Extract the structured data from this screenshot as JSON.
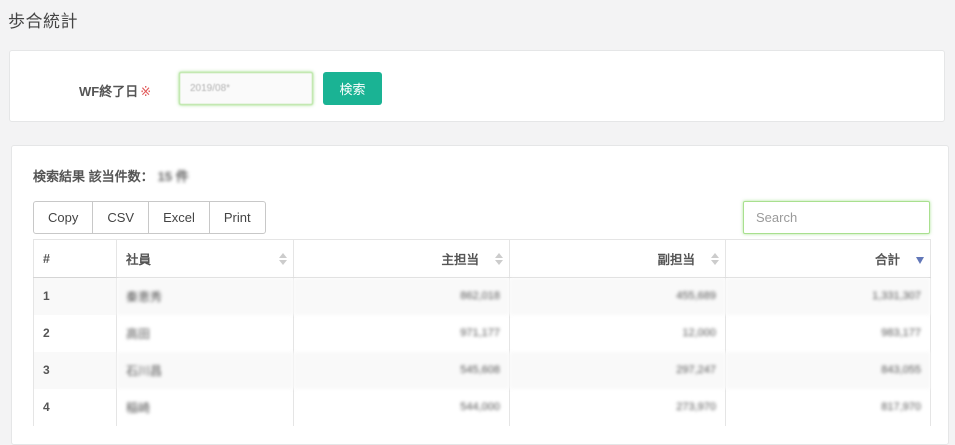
{
  "page": {
    "title": "歩合統計"
  },
  "filter": {
    "label": "WF終了日",
    "required_mark": "※",
    "date_value": "2019/08*",
    "search_button": "検索"
  },
  "results": {
    "title": "検索結果 該当件数：",
    "count": "15 件",
    "export_buttons": [
      "Copy",
      "CSV",
      "Excel",
      "Print"
    ],
    "search_placeholder": "Search",
    "columns": [
      "#",
      "社員",
      "主担当",
      "副担当",
      "合計"
    ],
    "sorted_column": "合計",
    "sort_direction": "descending",
    "rows": [
      {
        "idx": "1",
        "name": "秦恵秀",
        "main": "862,018",
        "sub": "455,689",
        "total": "1,331,307"
      },
      {
        "idx": "2",
        "name": "高田",
        "main": "971,177",
        "sub": "12,000",
        "total": "983,177"
      },
      {
        "idx": "3",
        "name": "石川昌",
        "main": "545,608",
        "sub": "297,247",
        "total": "843,055"
      },
      {
        "idx": "4",
        "name": "稲崎",
        "main": "544,000",
        "sub": "273,970",
        "total": "817,970"
      }
    ]
  },
  "colors": {
    "accent": "#1ab394",
    "focus_border": "#a9e08f",
    "link_number": "#5a8ed0",
    "sort_active": "#6277b8"
  }
}
